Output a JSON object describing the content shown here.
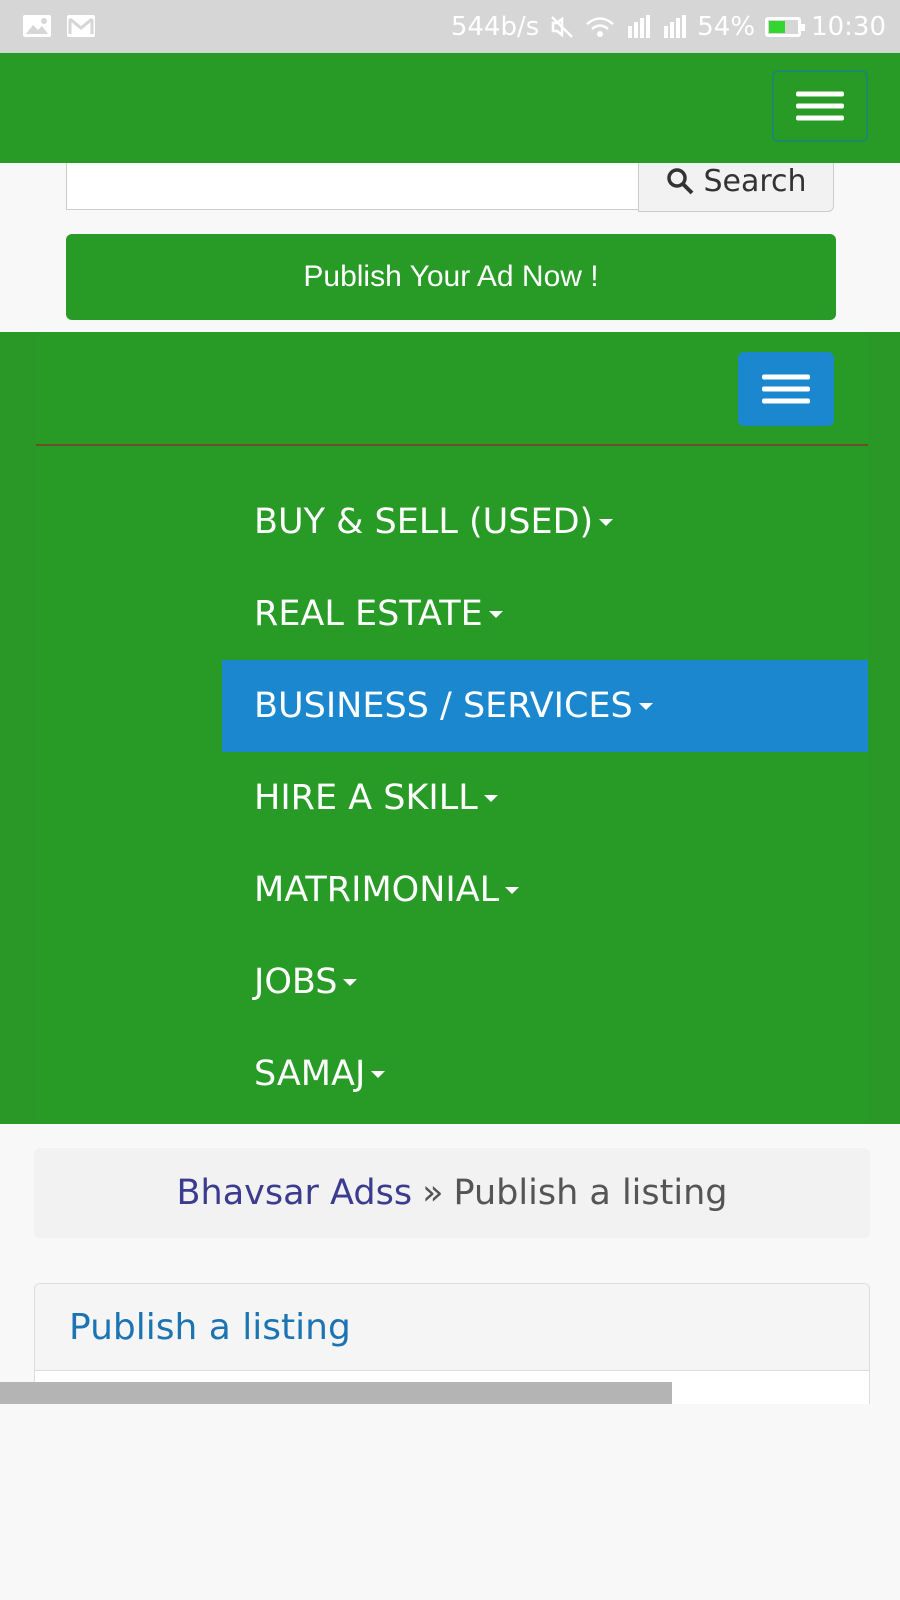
{
  "status_bar": {
    "speed": "544b/s",
    "battery": "54%",
    "battery_level": 0.54,
    "time": "10:30",
    "icons": [
      "gallery-icon",
      "gmail-icon",
      "mute-icon",
      "wifi-icon",
      "hd-signal-icon",
      "signal-icon",
      "signal-icon",
      "battery-icon"
    ]
  },
  "search": {
    "button_label": "Search",
    "input_value": ""
  },
  "publish_button": {
    "label": "Publish Your Ad Now !"
  },
  "category_menu": {
    "items": [
      {
        "label": "BUY & SELL (USED)",
        "active": false
      },
      {
        "label": "REAL ESTATE",
        "active": false
      },
      {
        "label": "BUSINESS / SERVICES",
        "active": true
      },
      {
        "label": "HIRE A SKILL",
        "active": false
      },
      {
        "label": "MATRIMONIAL",
        "active": false
      },
      {
        "label": "JOBS",
        "active": false
      },
      {
        "label": "SAMAJ",
        "active": false
      }
    ]
  },
  "breadcrumb": {
    "home": "Bhavsar Adss",
    "separator": "»",
    "current": "Publish a listing"
  },
  "panel": {
    "heading": "Publish a listing"
  },
  "colors": {
    "brand_green": "#279b26",
    "accent_blue": "#1b87cf",
    "heading_blue": "#1c74b3"
  }
}
